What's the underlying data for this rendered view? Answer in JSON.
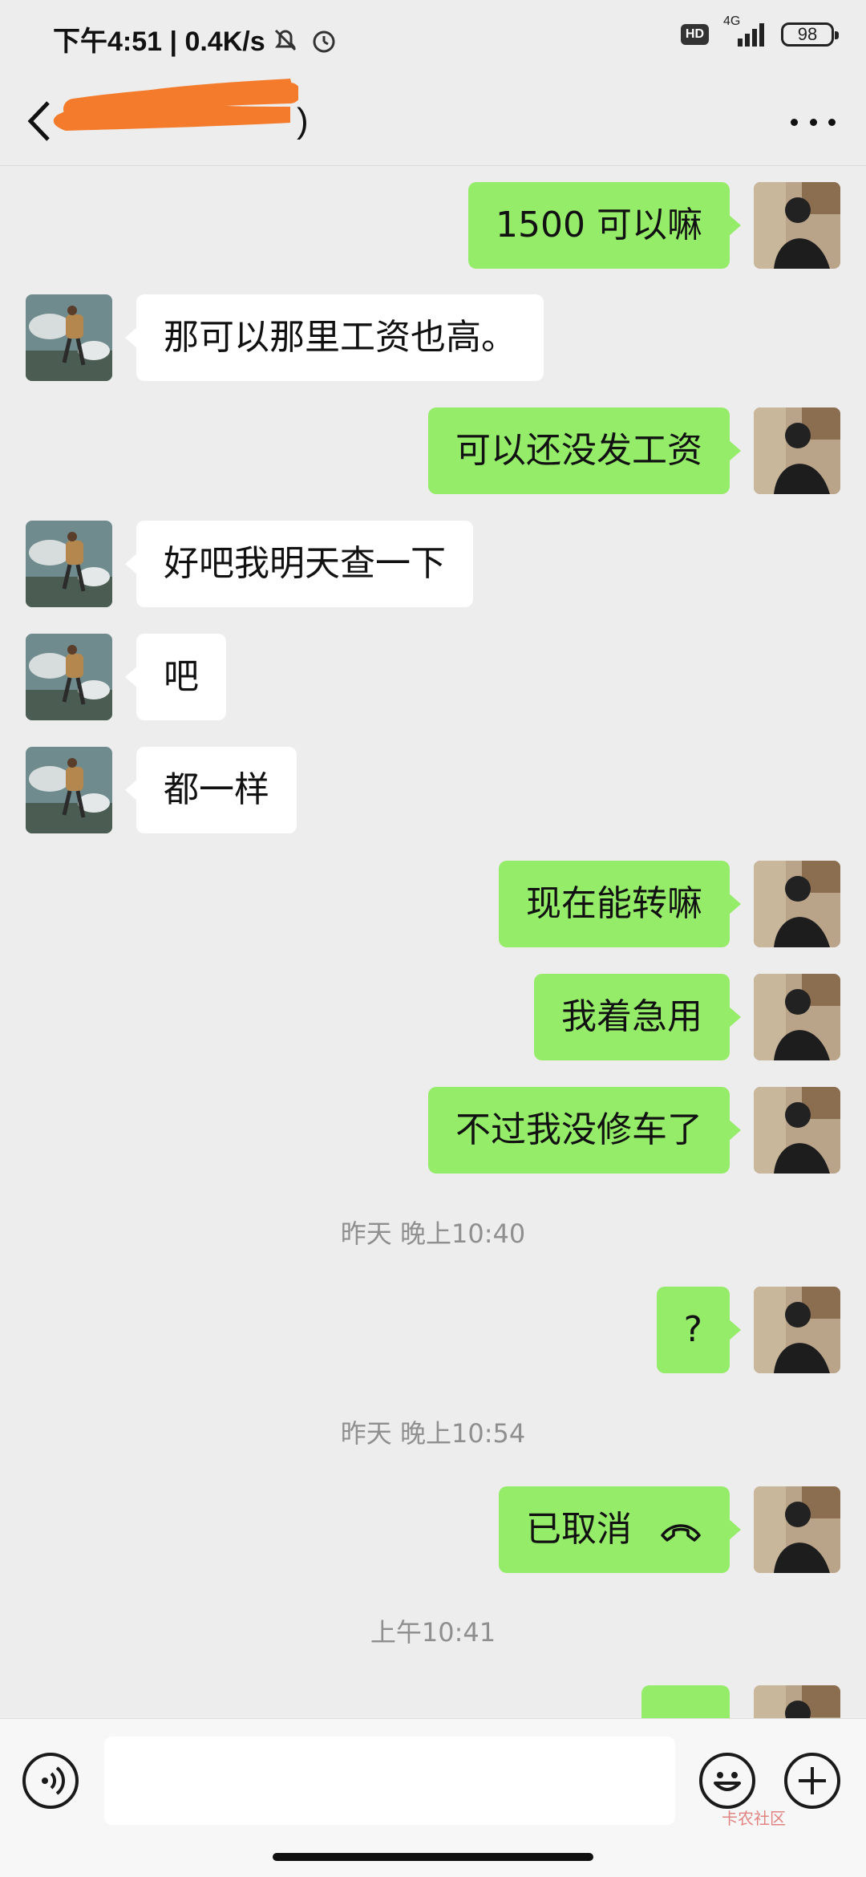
{
  "status_bar": {
    "time_speed": "下午4:51 | 0.4K/s",
    "hd": "HD",
    "network": "4G",
    "battery": "98"
  },
  "header": {
    "title": ")",
    "back_icon": "chevron-left-icon",
    "more_icon": "more-dots-icon"
  },
  "messages": [
    {
      "side": "me",
      "text": "1500 可以嘛"
    },
    {
      "side": "other",
      "text": "那可以那里工资也高。"
    },
    {
      "side": "me",
      "text": "可以还没发工资"
    },
    {
      "side": "other",
      "text": "好吧我明天查一下"
    },
    {
      "side": "other",
      "text": "吧"
    },
    {
      "side": "other",
      "text": "都一样"
    },
    {
      "side": "me",
      "text": "现在能转嘛"
    },
    {
      "side": "me",
      "text": "我着急用"
    },
    {
      "side": "me",
      "text": "不过我没修车了"
    },
    {
      "timestamp": "昨天 晚上10:40"
    },
    {
      "side": "me",
      "text": "?"
    },
    {
      "timestamp": "昨天 晚上10:54"
    },
    {
      "side": "me",
      "text": "已取消",
      "icon": "phone-hangup-icon"
    },
    {
      "timestamp": "上午10:41"
    },
    {
      "side": "me",
      "text": "..."
    }
  ],
  "input_bar": {
    "voice_icon": "voice-icon",
    "emoji_icon": "emoji-icon",
    "plus_icon": "plus-icon",
    "input_value": "",
    "watermark": "卡农社区"
  },
  "colors": {
    "background": "#ededed",
    "my_bubble": "#95ec69",
    "other_bubble": "#ffffff",
    "timestamp": "#8f8f8f",
    "redaction": "#f47b2b"
  }
}
